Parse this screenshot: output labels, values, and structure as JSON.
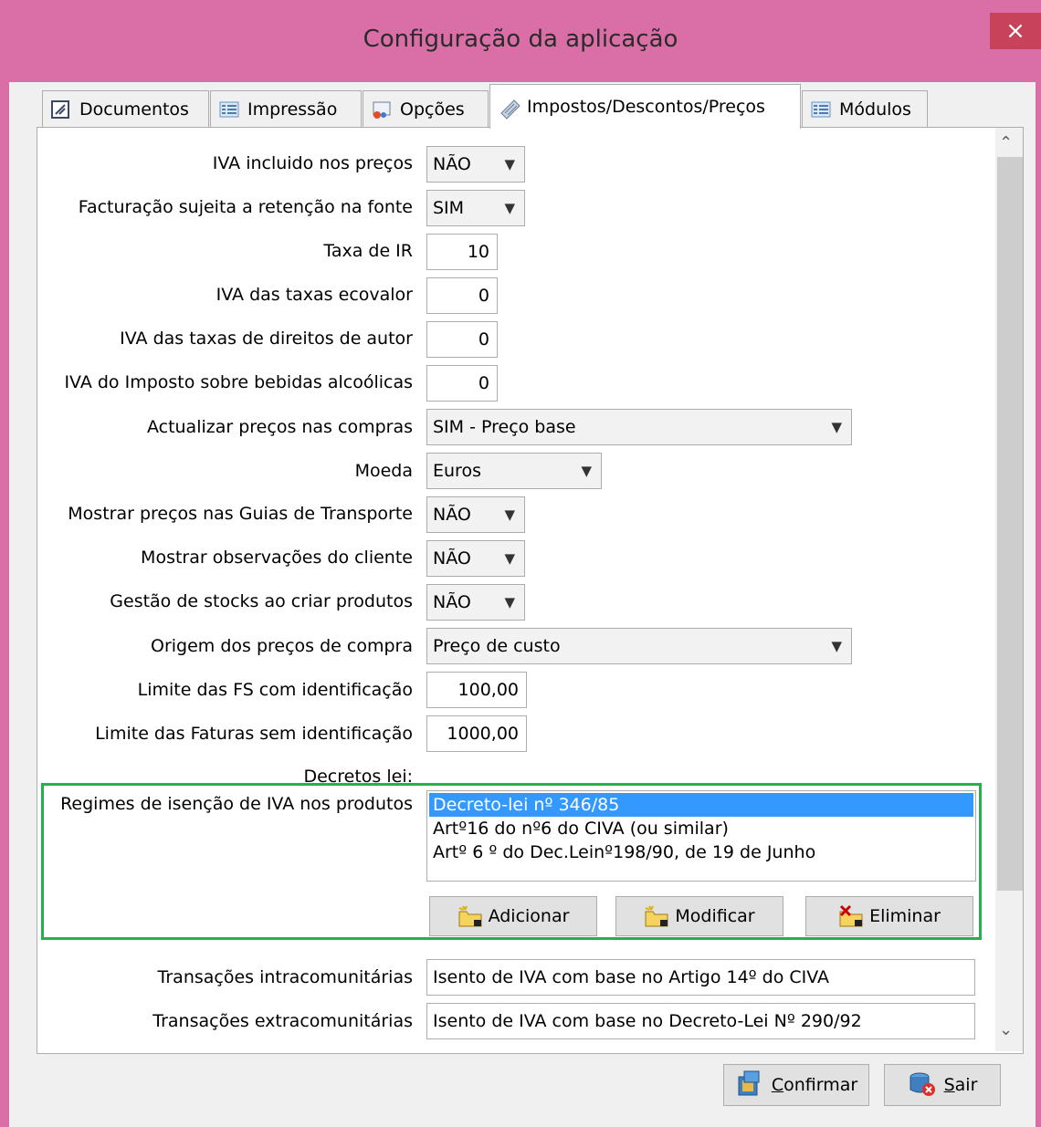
{
  "window": {
    "title": "Configuração da aplicação",
    "close_label": "×"
  },
  "tabs": [
    {
      "label": "Documentos",
      "icon": "documents-icon"
    },
    {
      "label": "Impressão",
      "icon": "print-list-icon"
    },
    {
      "label": "Opções",
      "icon": "options-icon"
    },
    {
      "label": "Impostos/Descontos/Preços",
      "icon": "taxes-icon",
      "active": true
    },
    {
      "label": "Módulos",
      "icon": "modules-icon"
    }
  ],
  "fields": {
    "iva_incluido": {
      "label": "IVA incluido nos preços",
      "value": "NÃO"
    },
    "retencao": {
      "label": "Facturação sujeita a retenção na fonte",
      "value": "SIM"
    },
    "taxa_ir": {
      "label": "Taxa de IR",
      "value": "10"
    },
    "iva_ecovalor": {
      "label": "IVA das taxas ecovalor",
      "value": "0"
    },
    "iva_direitos": {
      "label": "IVA das taxas de direitos de autor",
      "value": "0"
    },
    "iva_bebidas": {
      "label": "IVA do Imposto sobre bebidas alcoólicas",
      "value": "0"
    },
    "actualizar_precos": {
      "label": "Actualizar preços nas compras",
      "value": "SIM - Preço base"
    },
    "moeda": {
      "label": "Moeda",
      "value": "Euros"
    },
    "precos_guias": {
      "label": "Mostrar preços nas Guias de Transporte",
      "value": "NÃO"
    },
    "observacoes": {
      "label": "Mostrar observações do cliente",
      "value": "NÃO"
    },
    "gestao_stocks": {
      "label": "Gestão de stocks ao criar produtos",
      "value": "NÃO"
    },
    "origem_precos": {
      "label": "Origem dos preços de compra",
      "value": "Preço de custo"
    },
    "limite_fs": {
      "label": "Limite das FS com identificação",
      "value": "100,00"
    },
    "limite_faturas": {
      "label": "Limite das Faturas sem identificação",
      "value": "1000,00"
    }
  },
  "decretos": {
    "heading": "Decretos lei:",
    "label": "Regimes de isenção de IVA nos produtos",
    "items": [
      "Decreto-lei nº 346/85",
      "Artº16 do nº6 do CIVA (ou similar)",
      "Artº 6 º do Dec.Leinº198/90, de 19 de Junho"
    ],
    "selected_index": 0,
    "buttons": {
      "add": "Adicionar",
      "modify": "Modificar",
      "delete": "Eliminar"
    }
  },
  "transacoes": {
    "intra_label": "Transações intracomunitárias",
    "intra_value": "Isento de IVA com base no Artigo 14º do CIVA",
    "extra_label": "Transações extracomunitárias",
    "extra_value": "Isento de IVA com base no Decreto-Lei Nº 290/92"
  },
  "footer": {
    "confirm": "Confirmar",
    "exit": "Sair"
  },
  "colors": {
    "titlebar": "#d96fa6",
    "close": "#c7425a",
    "highlight_group": "#22b14c",
    "selection": "#3399ff"
  }
}
